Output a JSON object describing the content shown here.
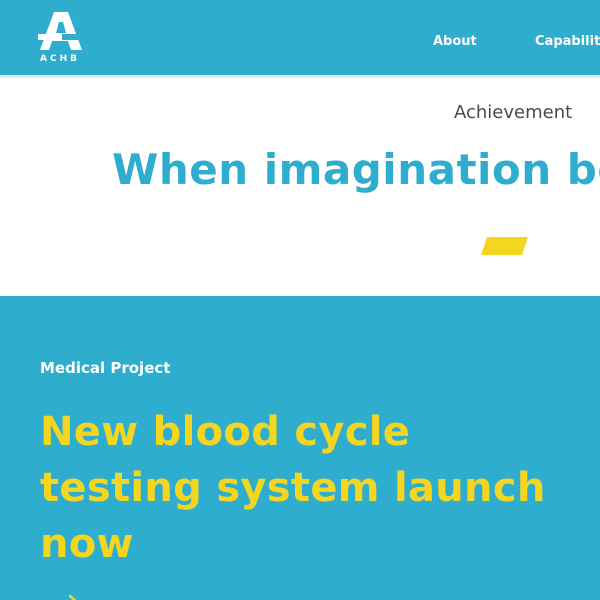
{
  "header": {
    "logo_text": "ACHB",
    "nav": {
      "about": "About",
      "capability": "Capability"
    }
  },
  "hero": {
    "label": "Achievement",
    "title": "When imagination be"
  },
  "project": {
    "label": "Medical Project",
    "title_lines": [
      "New blood cycle",
      "testing system launch",
      "now"
    ]
  },
  "icons": {
    "logo": "achb-logo-icon",
    "arrow": "arrow-right-icon"
  },
  "colors": {
    "brand_blue": "#2eadce",
    "accent_yellow": "#f4d621",
    "white": "#ffffff",
    "label_gray": "#4a4a4a"
  }
}
